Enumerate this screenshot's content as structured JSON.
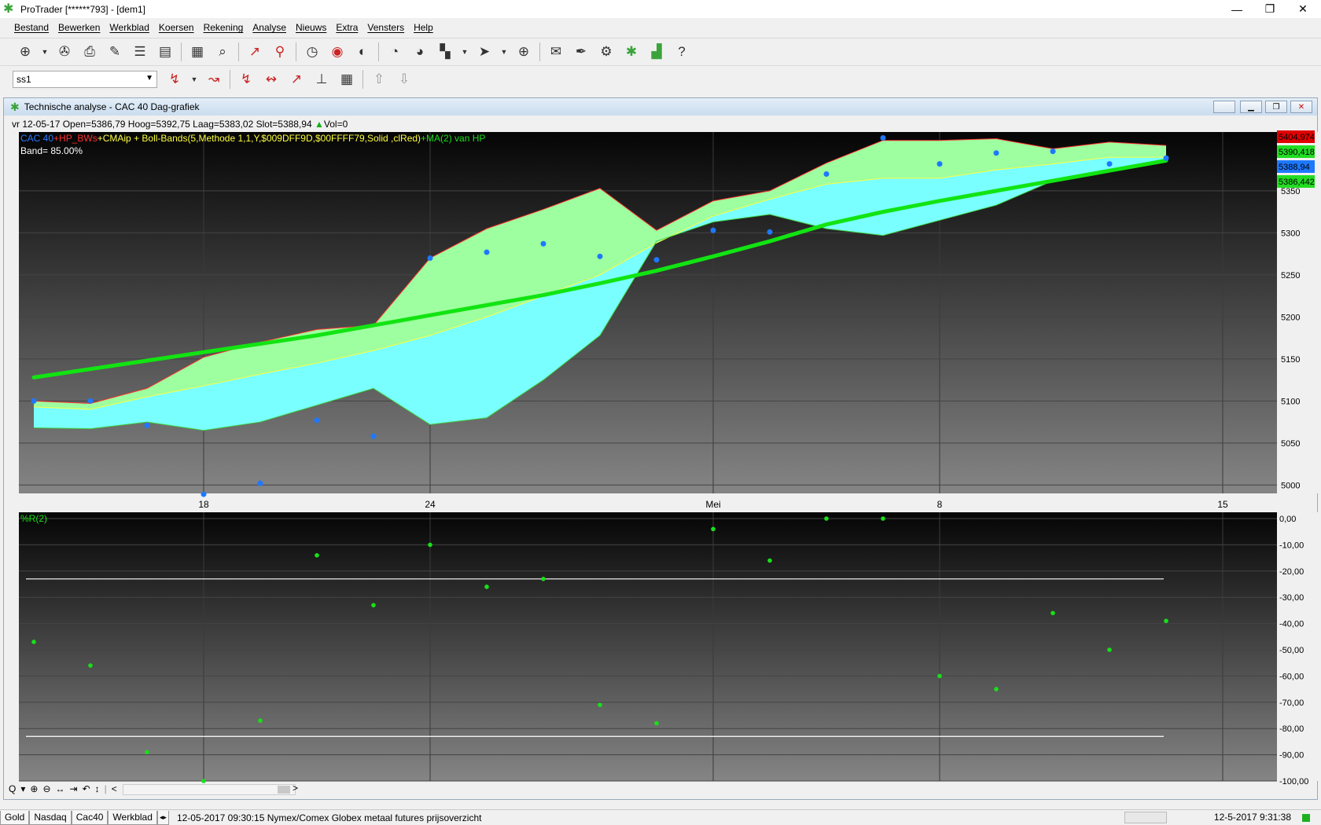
{
  "window": {
    "title": "ProTrader [******793] - [dem1]",
    "controls": {
      "minimize": "—",
      "restore": "❐",
      "close": "✕"
    }
  },
  "menu": [
    "Bestand",
    "Bewerken",
    "Werkblad",
    "Koersen",
    "Rekening",
    "Analyse",
    "Nieuws",
    "Extra",
    "Vensters",
    "Help"
  ],
  "toolbar2": {
    "combo_value": "ss1"
  },
  "mdi": {
    "title": "Technische analyse -   CAC 40 Dag-grafiek",
    "info": "vr 12-05-17  Open=5386,79  Hoog=5392,75  Laag=5383,02  Slot=5388,94",
    "vol": "Vol=0"
  },
  "colors": {
    "upper_band_fill": "#9dff9f",
    "lower_band_fill": "#79ffff",
    "ma_line": "#12e412",
    "price_dots": "#1e78ff",
    "indicator_dots": "#18e018",
    "upper_line": "#ff3030",
    "mid_line": "#ffff40",
    "hline": "#ffffff"
  },
  "chart_data": [
    {
      "type": "area",
      "legend": [
        {
          "text": "CAC 40",
          "color": "#2a7bff"
        },
        {
          "text": "+HP_BWs",
          "color": "#ff3030"
        },
        {
          "text": "+CMAip + Boll-Bands(5,Methode 1,1,Y,$009DFF9D,$00FFFF79,Solid",
          "color": "#ffff40"
        },
        {
          "text": "     ,clRed)",
          "color": "#ffff40"
        },
        {
          "text": "+MA(2) van HP",
          "color": "#18e018"
        }
      ],
      "annotation": "Band= 85.00%",
      "x_ticks": [
        {
          "label": "18",
          "day": 4
        },
        {
          "label": "24",
          "day": 8
        },
        {
          "label": "Mei",
          "day": 13
        },
        {
          "label": "8",
          "day": 17
        },
        {
          "label": "15",
          "day": 22
        }
      ],
      "ylim": [
        4990,
        5420
      ],
      "y_ticks": [
        5000,
        5050,
        5100,
        5150,
        5200,
        5250,
        5300,
        5350
      ],
      "price_tags": [
        {
          "value": "5404,974",
          "bg": "#e00000",
          "y": 5404.974
        },
        {
          "value": "5390,418",
          "bg": "#22dd22",
          "y": 5390.418
        },
        {
          "value": "5388,94",
          "bg": "#1e78ff",
          "y": 5388.94
        },
        {
          "value": "5386,442",
          "bg": "#22dd22",
          "y": 5386.442
        }
      ],
      "days": [
        1,
        2,
        3,
        4,
        5,
        6,
        7,
        8,
        9,
        10,
        11,
        12,
        13,
        14,
        15,
        16,
        17,
        18,
        19,
        20,
        21
      ],
      "upper": [
        5100,
        5097,
        5115,
        5152,
        5170,
        5185,
        5190,
        5270,
        5305,
        5328,
        5353,
        5303,
        5338,
        5350,
        5383,
        5410,
        5410,
        5412,
        5400,
        5408,
        5404
      ],
      "middle": [
        5093,
        5090,
        5105,
        5118,
        5132,
        5145,
        5160,
        5178,
        5200,
        5225,
        5250,
        5288,
        5320,
        5340,
        5358,
        5365,
        5365,
        5375,
        5382,
        5390,
        5390
      ],
      "lower": [
        5068,
        5067,
        5075,
        5065,
        5075,
        5095,
        5115,
        5072,
        5080,
        5125,
        5178,
        5290,
        5313,
        5322,
        5305,
        5297,
        5315,
        5333,
        5362,
        5375,
        5386
      ],
      "ma": [
        5128,
        5138,
        5148,
        5158,
        5168,
        5178,
        5190,
        5202,
        5214,
        5226,
        5240,
        5255,
        5272,
        5290,
        5310,
        5325,
        5338,
        5350,
        5362,
        5374,
        5386
      ],
      "price": [
        5100,
        5100,
        5071,
        4989,
        5002,
        5077,
        5058,
        5270,
        5277,
        5287,
        5272,
        5268,
        5303,
        5301,
        5370,
        5413,
        5382,
        5395,
        5397,
        5382,
        5388.94
      ]
    },
    {
      "type": "scatter",
      "legend": [
        {
          "text": "%R(2)",
          "color": "#18e018"
        }
      ],
      "ylim": [
        -100,
        0
      ],
      "y_ticks": [
        0,
        -10,
        -20,
        -30,
        -40,
        -50,
        -60,
        -70,
        -80,
        -90,
        -100
      ],
      "y_tick_labels": [
        "0,00",
        "-10,00",
        "-20,00",
        "-30,00",
        "-40,00",
        "-50,00",
        "-60,00",
        "-70,00",
        "-80,00",
        "-90,00",
        "-100,00"
      ],
      "hlines": [
        -23,
        -83
      ],
      "days": [
        1,
        2,
        3,
        4,
        5,
        6,
        7,
        8,
        9,
        10,
        11,
        12,
        13,
        14,
        15,
        16,
        17,
        18,
        19,
        20,
        21
      ],
      "values": [
        -47,
        -56,
        -89,
        -100,
        -77,
        -14,
        -33,
        -10,
        -26,
        -23,
        -71,
        -78,
        -4,
        -16,
        0,
        0,
        -60,
        -65,
        -36,
        -50,
        -39
      ]
    }
  ],
  "zoombar": [
    "Q",
    "▾",
    "⊕",
    "⊖",
    "↔",
    "⇥",
    "↶",
    "↕",
    "|",
    "<",
    ">"
  ],
  "statusbar": {
    "tabs": [
      "Gold",
      "Nasdaq",
      "Cac40",
      "Werkblad"
    ],
    "message": "12-05-2017 09:30:15 Nymex/Comex Globex metaal futures prijsoverzicht",
    "time": "12-5-2017 9:31:38"
  }
}
